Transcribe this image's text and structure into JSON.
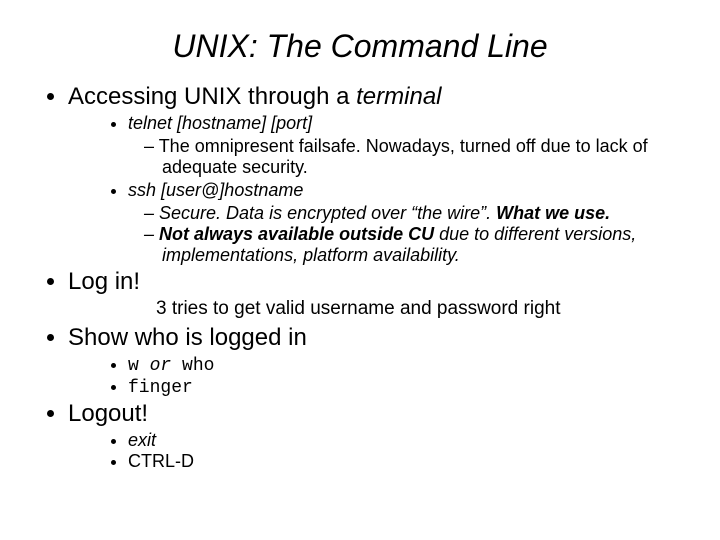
{
  "title": "UNIX: The Command Line",
  "items": [
    {
      "label": "Accessing UNIX through a ",
      "label_em": "terminal",
      "sub": [
        {
          "text": "telnet [hostname] [port]",
          "dash": [
            "The omnipresent failsafe.  Nowadays, turned off due to lack of adequate security."
          ]
        },
        {
          "text": "ssh [user@]hostname",
          "dash": [
            {
              "pre": "Secure. Data is encrypted over “the wire”. ",
              "bold": "What we use."
            },
            {
              "bold_pre": "Not always available outside CU",
              "post": " due to different versions, implementations, platform availability."
            }
          ]
        }
      ]
    },
    {
      "label": "Log in!",
      "note": "3 tries to get valid username and password right"
    },
    {
      "label": "Show who is logged in",
      "mono": [
        {
          "a": "w",
          "mid": " or ",
          "b": "who"
        },
        {
          "a": "finger"
        }
      ]
    },
    {
      "label": "Logout!",
      "sub_plain": [
        {
          "text": "exit",
          "italic": true
        },
        {
          "text": "CTRL-D",
          "italic": false
        }
      ]
    }
  ]
}
